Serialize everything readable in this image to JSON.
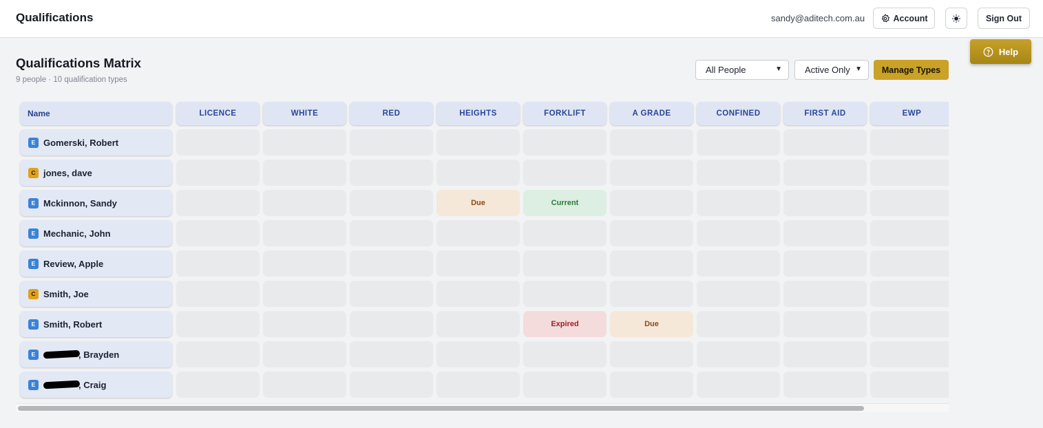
{
  "header": {
    "app_title": "Qualifications",
    "user_email": "sandy@aditech.com.au",
    "account_label": "Account",
    "signout_label": "Sign Out",
    "help_label": "Help"
  },
  "page": {
    "title": "Qualifications Matrix",
    "subtitle": "9 people · 10 qualification types"
  },
  "filters": {
    "people_selected": "All People",
    "status_selected": "Active Only",
    "manage_label": "Manage Types"
  },
  "matrix": {
    "name_header": "Name",
    "columns": [
      "LICENCE",
      "WHITE",
      "RED",
      "HEIGHTS",
      "FORKLIFT",
      "A GRADE",
      "CONFINED",
      "FIRST AID",
      "EWP"
    ],
    "rows": [
      {
        "badge": "E",
        "name": "Gomerski, Robert",
        "redacted": false,
        "cells": [
          "",
          "",
          "",
          "",
          "",
          "",
          "",
          "",
          ""
        ]
      },
      {
        "badge": "C",
        "name": "jones, dave",
        "redacted": false,
        "cells": [
          "",
          "",
          "",
          "",
          "",
          "",
          "",
          "",
          ""
        ]
      },
      {
        "badge": "E",
        "name": "Mckinnon, Sandy",
        "redacted": false,
        "cells": [
          "",
          "",
          "",
          "Due",
          "Current",
          "",
          "",
          "",
          ""
        ]
      },
      {
        "badge": "E",
        "name": "Mechanic, John",
        "redacted": false,
        "cells": [
          "",
          "",
          "",
          "",
          "",
          "",
          "",
          "",
          ""
        ]
      },
      {
        "badge": "E",
        "name": "Review, Apple",
        "redacted": false,
        "cells": [
          "",
          "",
          "",
          "",
          "",
          "",
          "",
          "",
          ""
        ]
      },
      {
        "badge": "C",
        "name": "Smith, Joe",
        "redacted": false,
        "cells": [
          "",
          "",
          "",
          "",
          "",
          "",
          "",
          "",
          ""
        ]
      },
      {
        "badge": "E",
        "name": "Smith, Robert",
        "redacted": false,
        "cells": [
          "",
          "",
          "",
          "",
          "Expired",
          "Due",
          "",
          "",
          ""
        ]
      },
      {
        "badge": "E",
        "name": ", Brayden",
        "redacted": true,
        "cells": [
          "",
          "",
          "",
          "",
          "",
          "",
          "",
          "",
          ""
        ]
      },
      {
        "badge": "E",
        "name": ", Craig",
        "redacted": true,
        "cells": [
          "",
          "",
          "",
          "",
          "",
          "",
          "",
          "",
          ""
        ]
      }
    ]
  },
  "colors": {
    "accent": "#c9a227",
    "header_cell": "#dfe5f3",
    "due": "#f5e8d8",
    "current": "#dcefe2",
    "expired": "#f5dcdc"
  }
}
